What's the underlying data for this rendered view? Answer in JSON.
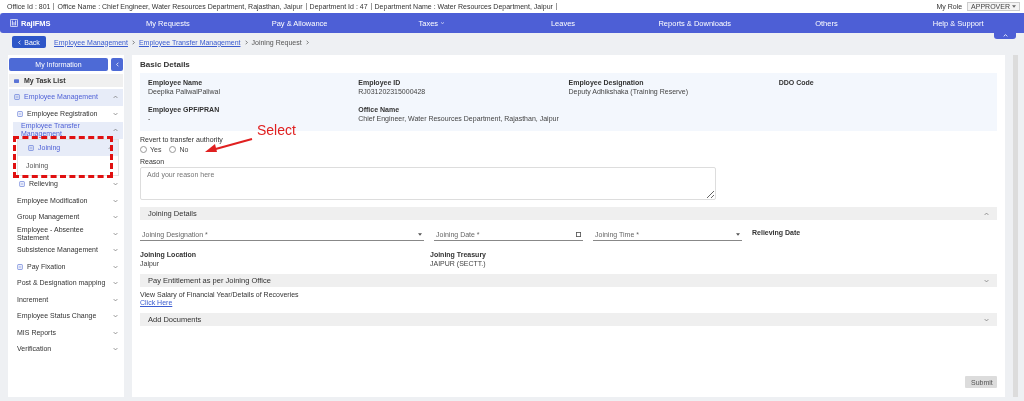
{
  "info_bar": {
    "items": [
      "Office Id : 801",
      "Office Name : Chief Engineer, Water Resources Department, Rajasthan, Jaipur",
      "Department Id : 47",
      "Department Name : Water Resources Department, Jaipur"
    ],
    "role_label": "My Role",
    "role_value": "APPROVER"
  },
  "nav": {
    "logo": "RajIFMS",
    "items": [
      {
        "label": "My Requests",
        "dropdown": false
      },
      {
        "label": "Pay & Allowance",
        "dropdown": false
      },
      {
        "label": "Taxes",
        "dropdown": true
      },
      {
        "label": "Leaves",
        "dropdown": false
      },
      {
        "label": "Reports & Downloads",
        "dropdown": false
      },
      {
        "label": "Others",
        "dropdown": false
      },
      {
        "label": "Help & Support",
        "dropdown": false
      }
    ]
  },
  "breadcrumb": {
    "back": "Back",
    "links": [
      "Employee Management",
      "Employee Transfer Management"
    ],
    "current": "Joining Request"
  },
  "sidebar": {
    "header": "My Information",
    "task_list": "My Task List",
    "tree": [
      {
        "label": "Employee Management",
        "kind": "icon",
        "expanded": true,
        "children": [
          {
            "label": "Employee Registration",
            "kind": "icon",
            "expanded": false
          },
          {
            "label": "Employee Transfer Management",
            "kind": "plain",
            "expanded": true,
            "children": [
              {
                "label": "Joining",
                "kind": "icon",
                "expanded": true,
                "children": [
                  {
                    "label": "Joining",
                    "kind": "plain"
                  }
                ]
              },
              {
                "label": "Relieving",
                "kind": "icon",
                "expanded": false
              }
            ]
          },
          {
            "label": "Employee Modification",
            "kind": "plain",
            "expanded": false
          },
          {
            "label": "Group Management",
            "kind": "plain",
            "expanded": false
          },
          {
            "label": "Employee - Absentee Statement",
            "kind": "plain",
            "expanded": false
          },
          {
            "label": "Subsistence Management",
            "kind": "plain",
            "expanded": false
          },
          {
            "label": "Pay Fixation",
            "kind": "icon",
            "expanded": false
          },
          {
            "label": "Post & Designation mapping",
            "kind": "plain",
            "expanded": false
          },
          {
            "label": "Increment",
            "kind": "plain",
            "expanded": false
          },
          {
            "label": "Employee Status Change",
            "kind": "plain",
            "expanded": false
          },
          {
            "label": "MIS Reports",
            "kind": "plain",
            "expanded": false
          },
          {
            "label": "Verification",
            "kind": "plain",
            "expanded": false
          }
        ]
      }
    ]
  },
  "basic_details": {
    "title": "Basic Details",
    "fields": [
      {
        "label": "Employee Name",
        "value": "Deepika PaliwalPaliwal"
      },
      {
        "label": "Employee ID",
        "value": "RJ031202315000428"
      },
      {
        "label": "Employee Designation",
        "value": "Deputy Adhikshaka (Training Reserve)"
      },
      {
        "label": "DDO Code"
      },
      {
        "label": "Employee GPF/PRAN",
        "value": "-"
      },
      {
        "label": "Office Name",
        "value": "Chief Engineer, Water Resources Department, Rajasthan, Jaipur"
      }
    ]
  },
  "revert": {
    "label": "Revert to transfer authority",
    "options": [
      {
        "label": "Yes",
        "selected": false
      },
      {
        "label": "No",
        "selected": false
      }
    ]
  },
  "reason": {
    "label": "Reason",
    "placeholder": "Add your reason here"
  },
  "joining_details": {
    "title": "Joining Details",
    "expanded": true,
    "inputs": [
      {
        "kind": "select",
        "placeholder": "Joining Designation *"
      },
      {
        "kind": "date",
        "placeholder": "Joining Date *"
      },
      {
        "kind": "select",
        "placeholder": "Joining Time *"
      },
      {
        "kind": "label",
        "placeholder": "Relieving Date"
      }
    ],
    "info": [
      {
        "label": "Joining Location",
        "value": "Jaipur"
      },
      {
        "label": "Joining Treasury",
        "value": "JAIPUR (SECTT.)"
      }
    ]
  },
  "pay_entitlement": {
    "title": "Pay Entitlement as per Joining Office",
    "expanded": false,
    "note": "View Salary of Financial Year/Details of Recoveries",
    "link": "Click Here"
  },
  "add_documents": {
    "title": "Add Documents",
    "expanded": false
  },
  "submit": "Submit",
  "annotation": {
    "label": "Select"
  }
}
